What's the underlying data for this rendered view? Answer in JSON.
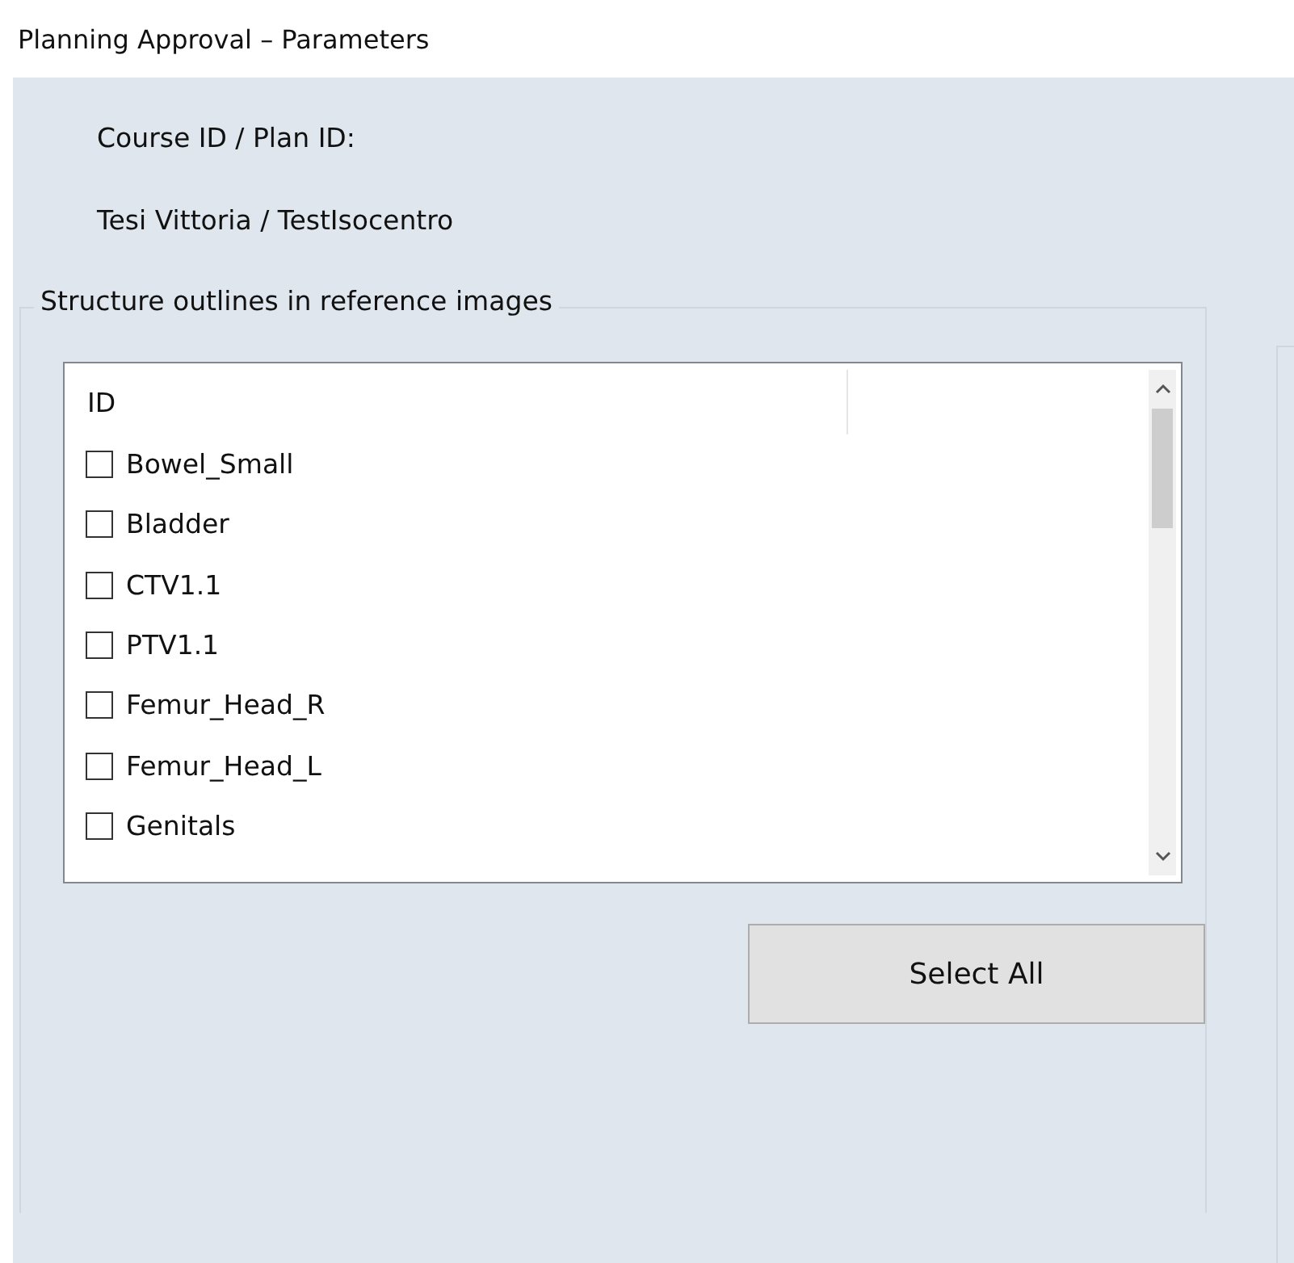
{
  "window": {
    "title": "Planning Approval – Parameters"
  },
  "course_plan": {
    "label": "Course ID / Plan ID:",
    "value": "Tesi Vittoria / TestIsocentro"
  },
  "structures": {
    "title": "Structure outlines in reference images",
    "columns": [
      "ID"
    ],
    "items": [
      {
        "label": "Bowel_Small",
        "checked": false
      },
      {
        "label": "Bladder",
        "checked": false
      },
      {
        "label": "CTV1.1",
        "checked": false
      },
      {
        "label": "PTV1.1",
        "checked": false
      },
      {
        "label": "Femur_Head_R",
        "checked": false
      },
      {
        "label": "Femur_Head_L",
        "checked": false
      },
      {
        "label": "Genitals",
        "checked": false
      }
    ],
    "select_all": "Select All"
  }
}
